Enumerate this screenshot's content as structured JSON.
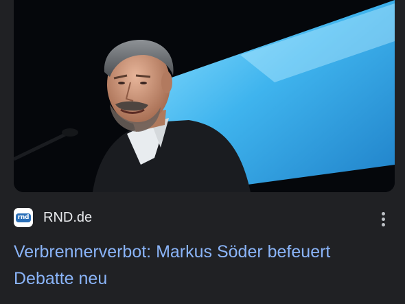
{
  "article": {
    "image_alt": "Markus Söder am Rednerpult vor blauer Leinwand",
    "source": {
      "favicon_label": "rnd",
      "name": "RND.de"
    },
    "more_icon": "more-vert-icon",
    "headline": "Verbrennerverbot: Markus Söder befeuert Debatte neu"
  },
  "colors": {
    "background": "#202124",
    "headline": "#8ab4f8",
    "source_text": "#e8eaed",
    "accent_screen": "#3fb4ee"
  }
}
